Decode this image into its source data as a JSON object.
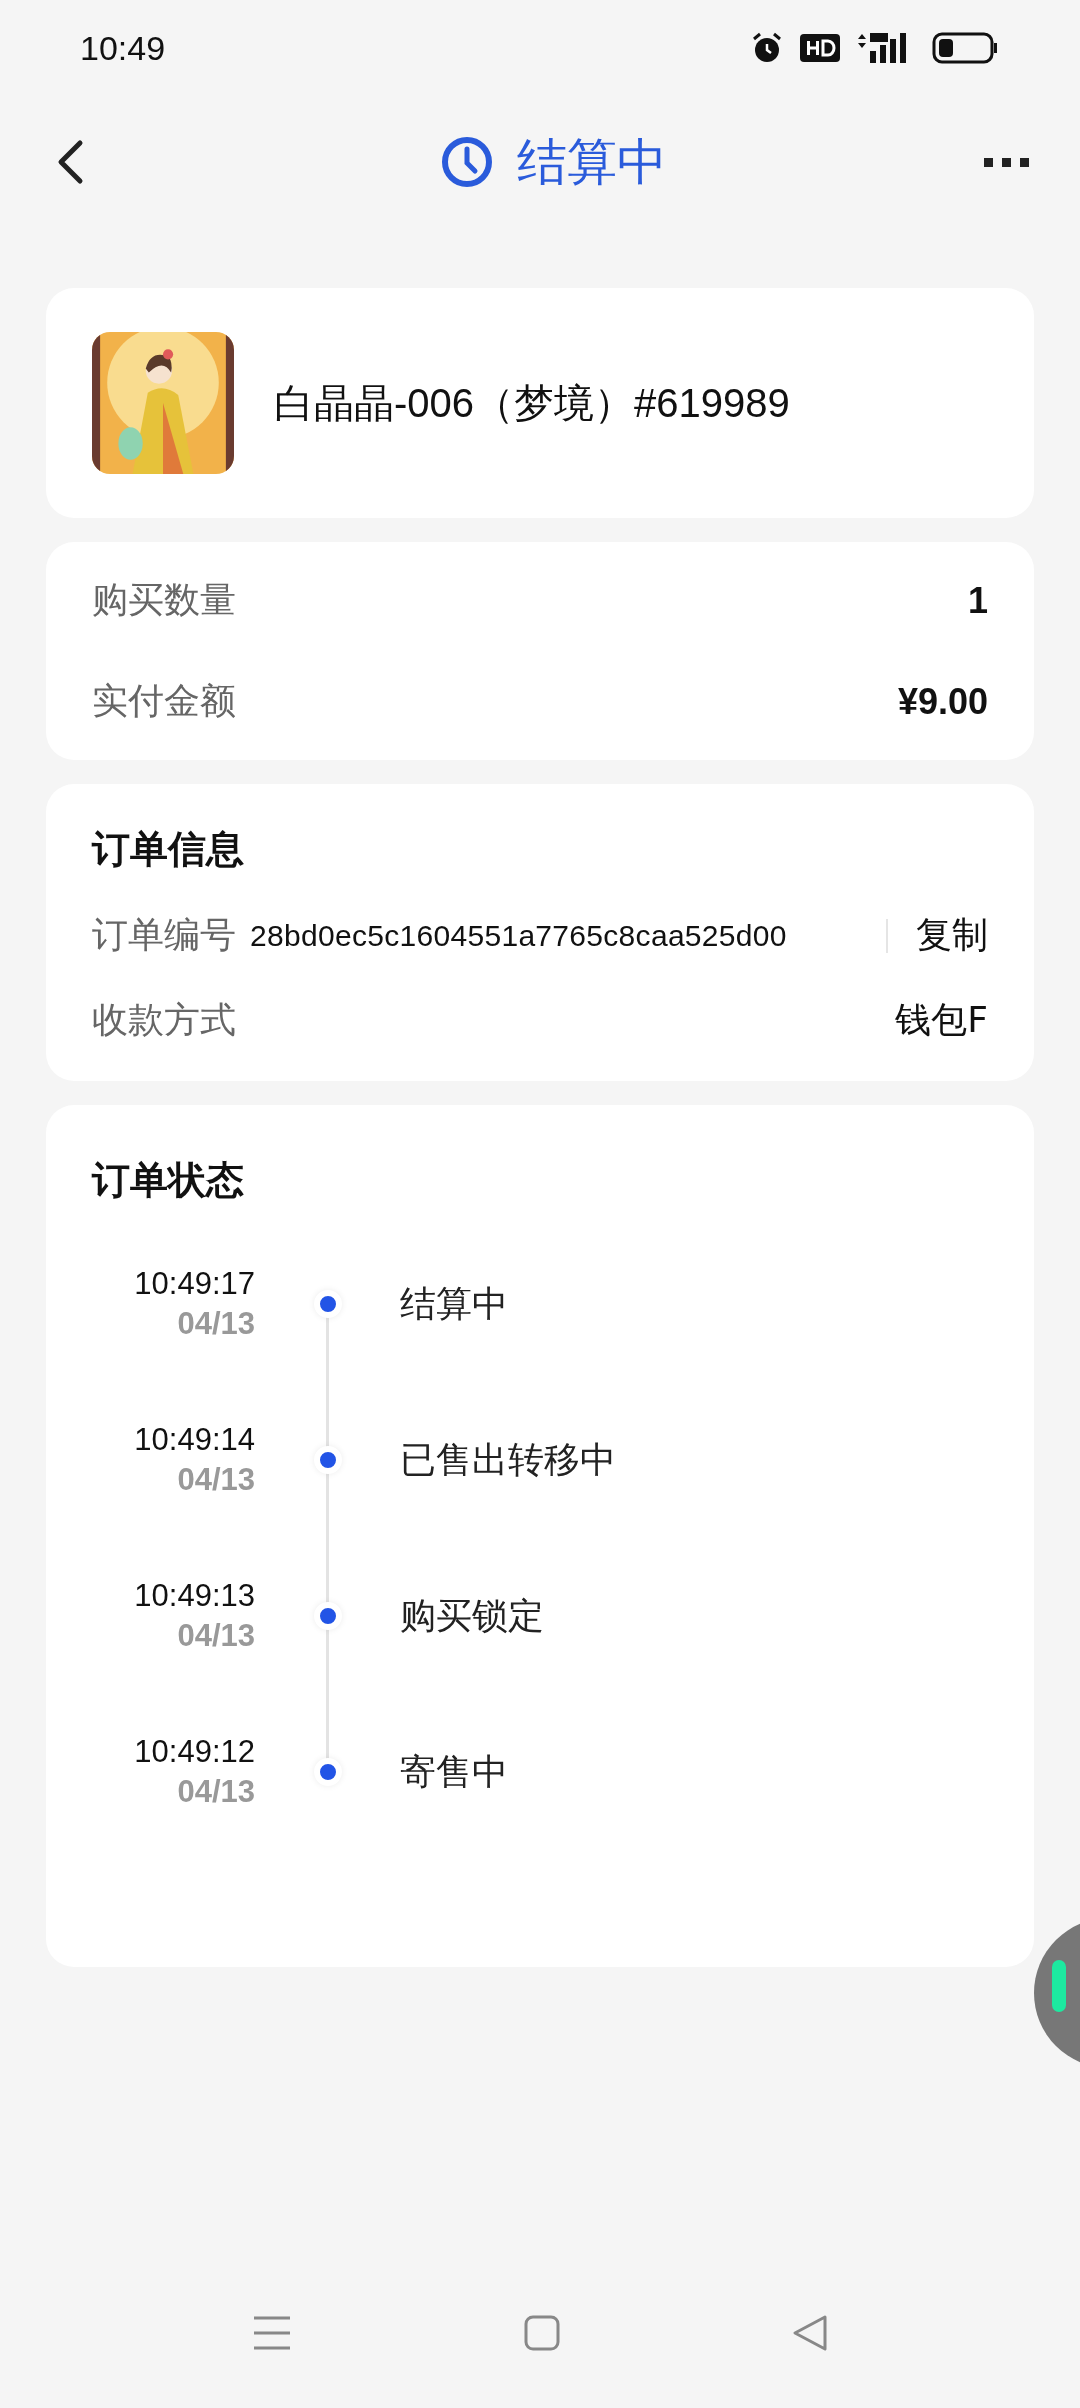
{
  "status_bar": {
    "time": "10:49"
  },
  "header": {
    "title": "结算中"
  },
  "product": {
    "name": "白晶晶-006（梦境）#619989"
  },
  "summary": [
    {
      "label": "购买数量",
      "value": "1"
    },
    {
      "label": "实付金额",
      "value": "¥9.00"
    }
  ],
  "order_info": {
    "title": "订单信息",
    "rows": [
      {
        "label": "订单编号",
        "value": "28bd0ec5c1604551a7765c8caa525d00",
        "action": "复制"
      },
      {
        "label": "收款方式",
        "value": "钱包F"
      }
    ]
  },
  "order_status": {
    "title": "订单状态",
    "events": [
      {
        "time": "10:49:17",
        "date": "04/13",
        "status": "结算中"
      },
      {
        "time": "10:49:14",
        "date": "04/13",
        "status": "已售出转移中"
      },
      {
        "time": "10:49:13",
        "date": "04/13",
        "status": "购买锁定"
      },
      {
        "time": "10:49:12",
        "date": "04/13",
        "status": "寄售中"
      }
    ]
  }
}
